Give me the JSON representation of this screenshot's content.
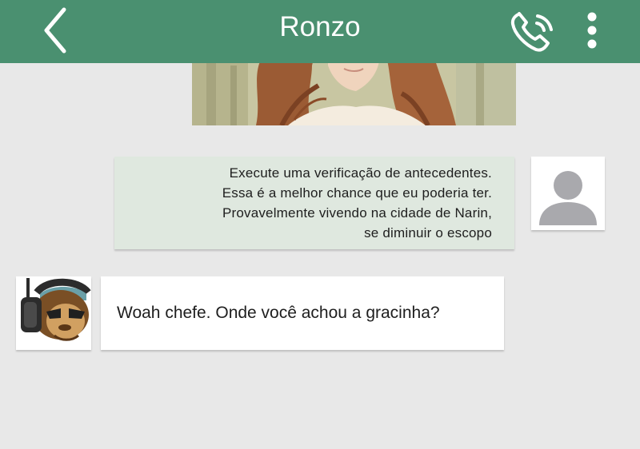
{
  "app": {
    "colors": {
      "header": "#4a9070",
      "background": "#e8e8e8",
      "outgoing_bubble": "#dfe8df",
      "incoming_bubble": "#ffffff"
    }
  },
  "header": {
    "title": "Ronzo",
    "icons": [
      "back-icon",
      "phone-icon",
      "more-vertical-icon"
    ]
  },
  "messages": [
    {
      "direction": "outgoing",
      "type": "image"
    },
    {
      "direction": "outgoing",
      "type": "text",
      "lines": [
        "Execute uma verificação de antecedentes.",
        "Essa é a melhor chance que eu poderia ter.",
        "Provavelmente vivendo na cidade de Narin,",
        "se diminuir o escopo"
      ],
      "avatar": "default-user-icon"
    },
    {
      "direction": "incoming",
      "type": "text",
      "text": "Woah chefe. Onde você achou a gracinha?",
      "avatar": "monkey-headphones-avatar"
    }
  ]
}
